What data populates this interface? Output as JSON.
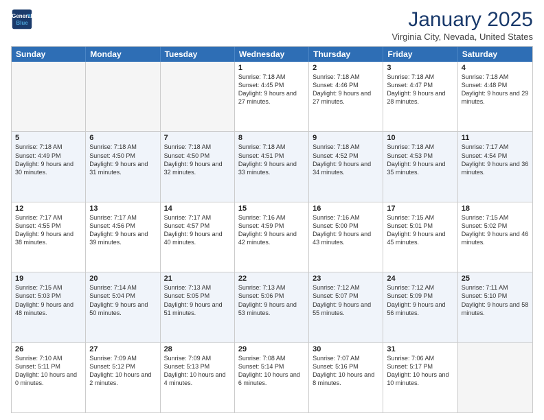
{
  "header": {
    "logo_line1": "General",
    "logo_line2": "Blue",
    "title": "January 2025",
    "subtitle": "Virginia City, Nevada, United States"
  },
  "days_of_week": [
    "Sunday",
    "Monday",
    "Tuesday",
    "Wednesday",
    "Thursday",
    "Friday",
    "Saturday"
  ],
  "weeks": [
    [
      {
        "day": "",
        "info": ""
      },
      {
        "day": "",
        "info": ""
      },
      {
        "day": "",
        "info": ""
      },
      {
        "day": "1",
        "info": "Sunrise: 7:18 AM\nSunset: 4:45 PM\nDaylight: 9 hours and 27 minutes."
      },
      {
        "day": "2",
        "info": "Sunrise: 7:18 AM\nSunset: 4:46 PM\nDaylight: 9 hours and 27 minutes."
      },
      {
        "day": "3",
        "info": "Sunrise: 7:18 AM\nSunset: 4:47 PM\nDaylight: 9 hours and 28 minutes."
      },
      {
        "day": "4",
        "info": "Sunrise: 7:18 AM\nSunset: 4:48 PM\nDaylight: 9 hours and 29 minutes."
      }
    ],
    [
      {
        "day": "5",
        "info": "Sunrise: 7:18 AM\nSunset: 4:49 PM\nDaylight: 9 hours and 30 minutes."
      },
      {
        "day": "6",
        "info": "Sunrise: 7:18 AM\nSunset: 4:50 PM\nDaylight: 9 hours and 31 minutes."
      },
      {
        "day": "7",
        "info": "Sunrise: 7:18 AM\nSunset: 4:50 PM\nDaylight: 9 hours and 32 minutes."
      },
      {
        "day": "8",
        "info": "Sunrise: 7:18 AM\nSunset: 4:51 PM\nDaylight: 9 hours and 33 minutes."
      },
      {
        "day": "9",
        "info": "Sunrise: 7:18 AM\nSunset: 4:52 PM\nDaylight: 9 hours and 34 minutes."
      },
      {
        "day": "10",
        "info": "Sunrise: 7:18 AM\nSunset: 4:53 PM\nDaylight: 9 hours and 35 minutes."
      },
      {
        "day": "11",
        "info": "Sunrise: 7:17 AM\nSunset: 4:54 PM\nDaylight: 9 hours and 36 minutes."
      }
    ],
    [
      {
        "day": "12",
        "info": "Sunrise: 7:17 AM\nSunset: 4:55 PM\nDaylight: 9 hours and 38 minutes."
      },
      {
        "day": "13",
        "info": "Sunrise: 7:17 AM\nSunset: 4:56 PM\nDaylight: 9 hours and 39 minutes."
      },
      {
        "day": "14",
        "info": "Sunrise: 7:17 AM\nSunset: 4:57 PM\nDaylight: 9 hours and 40 minutes."
      },
      {
        "day": "15",
        "info": "Sunrise: 7:16 AM\nSunset: 4:59 PM\nDaylight: 9 hours and 42 minutes."
      },
      {
        "day": "16",
        "info": "Sunrise: 7:16 AM\nSunset: 5:00 PM\nDaylight: 9 hours and 43 minutes."
      },
      {
        "day": "17",
        "info": "Sunrise: 7:15 AM\nSunset: 5:01 PM\nDaylight: 9 hours and 45 minutes."
      },
      {
        "day": "18",
        "info": "Sunrise: 7:15 AM\nSunset: 5:02 PM\nDaylight: 9 hours and 46 minutes."
      }
    ],
    [
      {
        "day": "19",
        "info": "Sunrise: 7:15 AM\nSunset: 5:03 PM\nDaylight: 9 hours and 48 minutes."
      },
      {
        "day": "20",
        "info": "Sunrise: 7:14 AM\nSunset: 5:04 PM\nDaylight: 9 hours and 50 minutes."
      },
      {
        "day": "21",
        "info": "Sunrise: 7:13 AM\nSunset: 5:05 PM\nDaylight: 9 hours and 51 minutes."
      },
      {
        "day": "22",
        "info": "Sunrise: 7:13 AM\nSunset: 5:06 PM\nDaylight: 9 hours and 53 minutes."
      },
      {
        "day": "23",
        "info": "Sunrise: 7:12 AM\nSunset: 5:07 PM\nDaylight: 9 hours and 55 minutes."
      },
      {
        "day": "24",
        "info": "Sunrise: 7:12 AM\nSunset: 5:09 PM\nDaylight: 9 hours and 56 minutes."
      },
      {
        "day": "25",
        "info": "Sunrise: 7:11 AM\nSunset: 5:10 PM\nDaylight: 9 hours and 58 minutes."
      }
    ],
    [
      {
        "day": "26",
        "info": "Sunrise: 7:10 AM\nSunset: 5:11 PM\nDaylight: 10 hours and 0 minutes."
      },
      {
        "day": "27",
        "info": "Sunrise: 7:09 AM\nSunset: 5:12 PM\nDaylight: 10 hours and 2 minutes."
      },
      {
        "day": "28",
        "info": "Sunrise: 7:09 AM\nSunset: 5:13 PM\nDaylight: 10 hours and 4 minutes."
      },
      {
        "day": "29",
        "info": "Sunrise: 7:08 AM\nSunset: 5:14 PM\nDaylight: 10 hours and 6 minutes."
      },
      {
        "day": "30",
        "info": "Sunrise: 7:07 AM\nSunset: 5:16 PM\nDaylight: 10 hours and 8 minutes."
      },
      {
        "day": "31",
        "info": "Sunrise: 7:06 AM\nSunset: 5:17 PM\nDaylight: 10 hours and 10 minutes."
      },
      {
        "day": "",
        "info": ""
      }
    ]
  ]
}
